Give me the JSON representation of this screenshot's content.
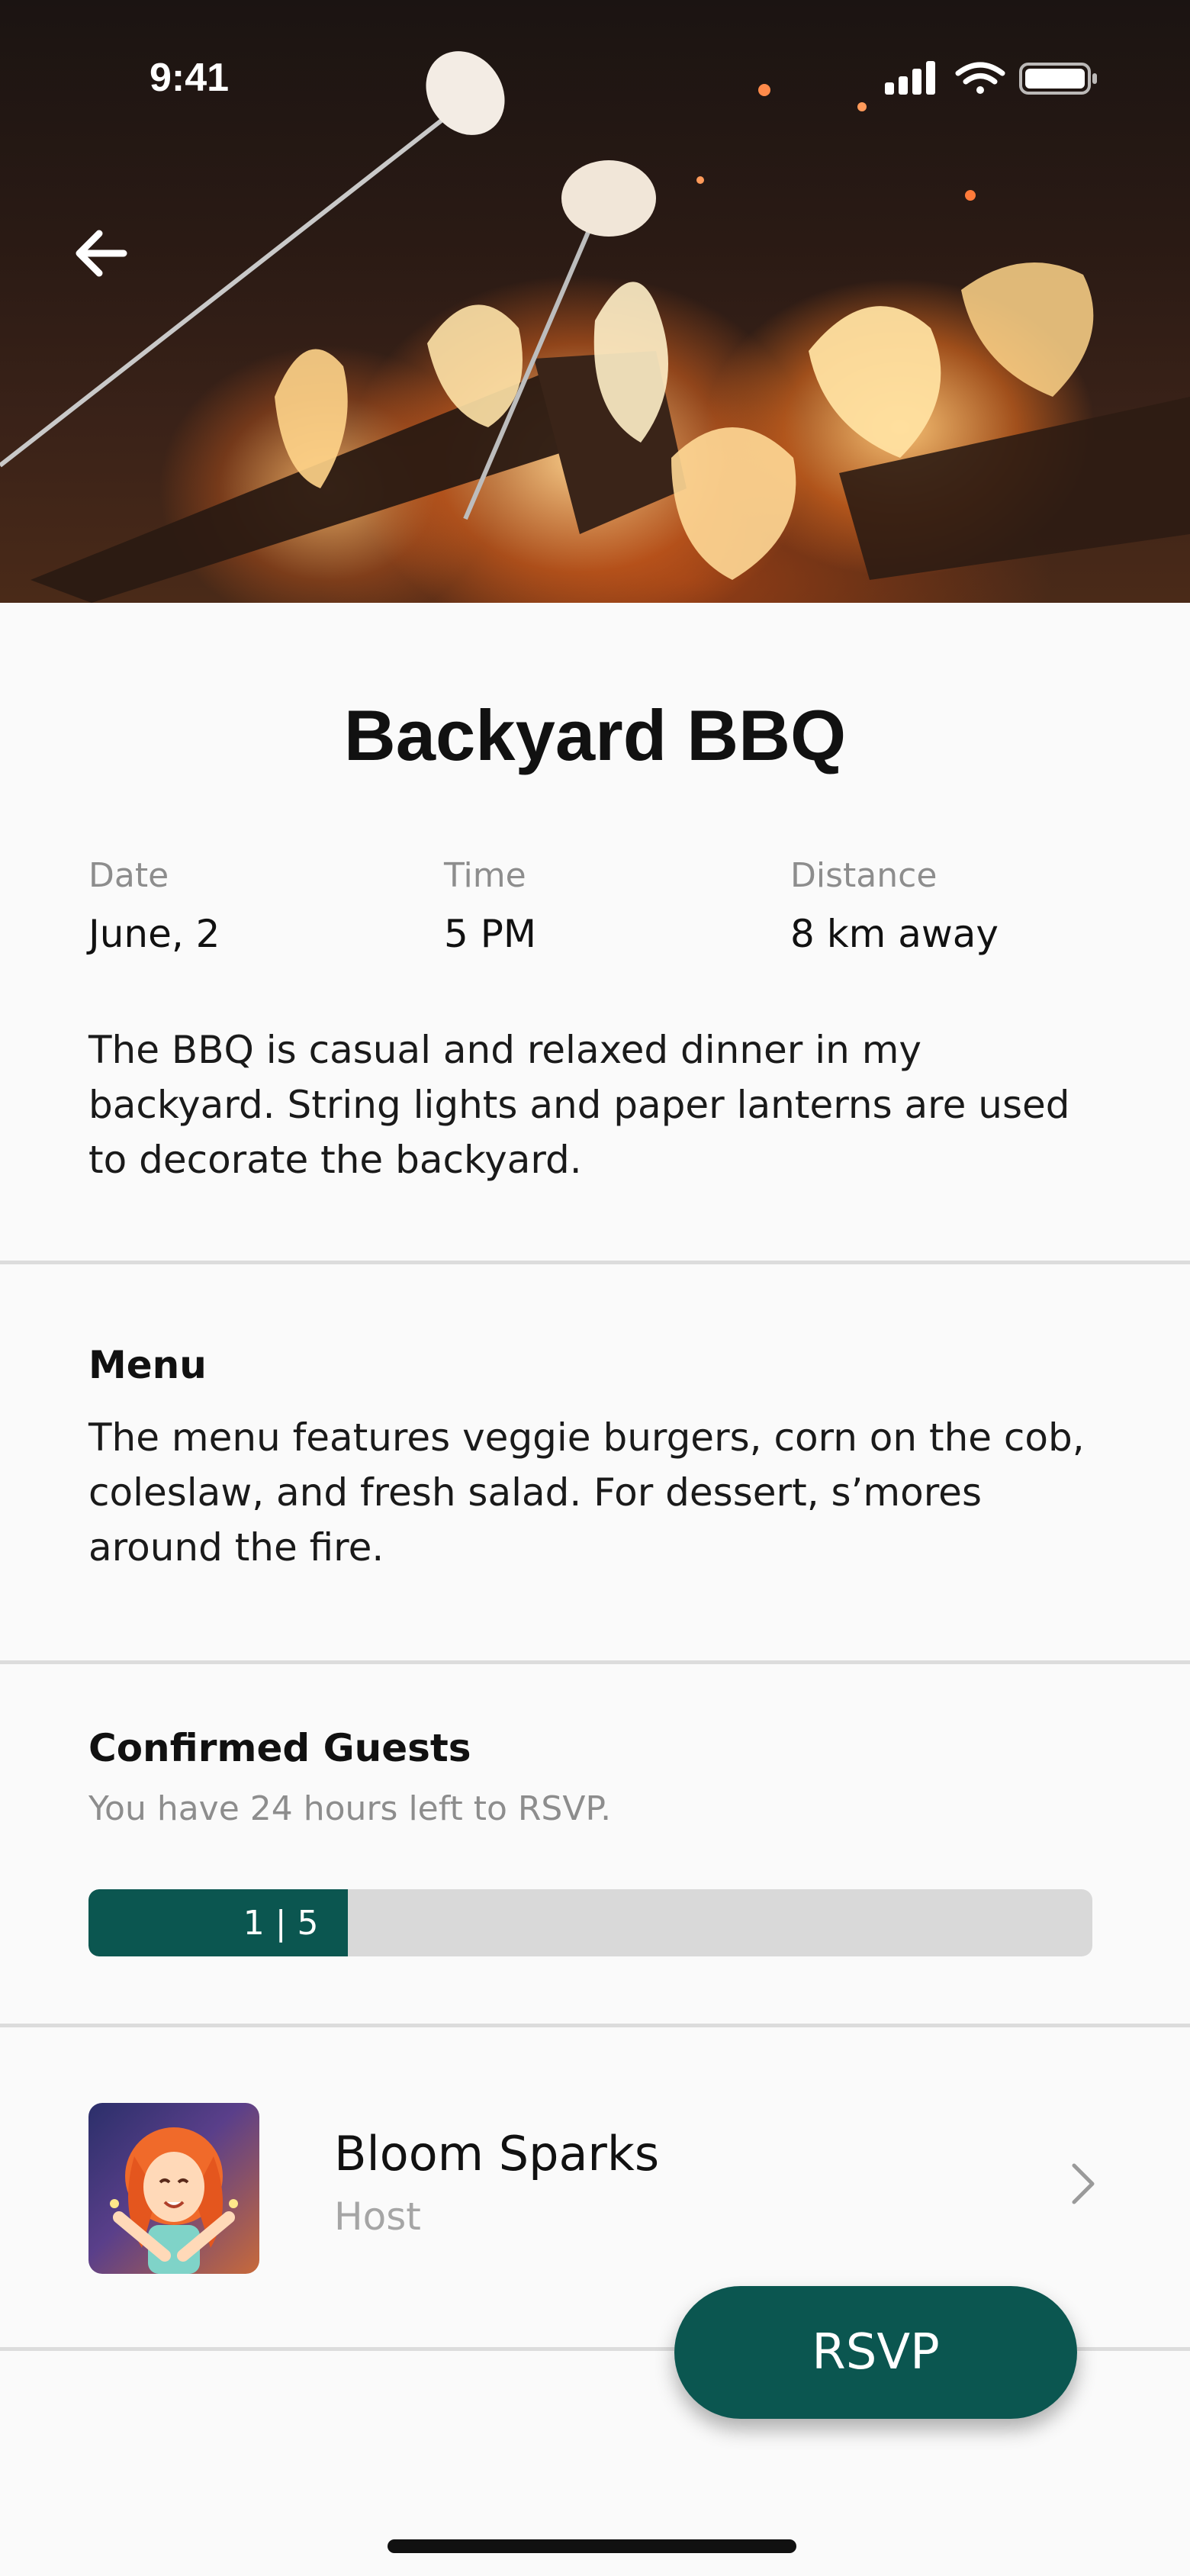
{
  "status_bar": {
    "time": "9:41"
  },
  "event": {
    "title": "Backyard BBQ",
    "date_label": "Date",
    "date_value": "June, 2",
    "time_label": "Time",
    "time_value": "5 PM",
    "distance_label": "Distance",
    "distance_value": "8 km away",
    "description": "The BBQ is casual and relaxed dinner in my backyard. String lights and paper lanterns are used to decorate the backyard."
  },
  "menu": {
    "heading": "Menu",
    "text": "The menu features veggie burgers, corn on the cob, coleslaw, and fresh salad. For dessert, s’mores around the fire."
  },
  "guests": {
    "heading": "Confirmed Guests",
    "subtitle": "You have 24 hours left to RSVP.",
    "progress_label": "1 | 5",
    "confirmed": 1,
    "capacity": 5,
    "progress_fraction": 0.2
  },
  "host": {
    "name": "Bloom Sparks",
    "role": "Host"
  },
  "actions": {
    "rsvp_label": "RSVP"
  },
  "icons": {
    "back": "arrow-left-icon",
    "chevron": "chevron-right-icon",
    "signal": "cellular-signal-icon",
    "wifi": "wifi-icon",
    "battery": "battery-icon"
  },
  "colors": {
    "accent": "#0b5650",
    "background": "#fafafa",
    "track": "#d9d9d9",
    "muted_text": "#8d8d8d"
  }
}
